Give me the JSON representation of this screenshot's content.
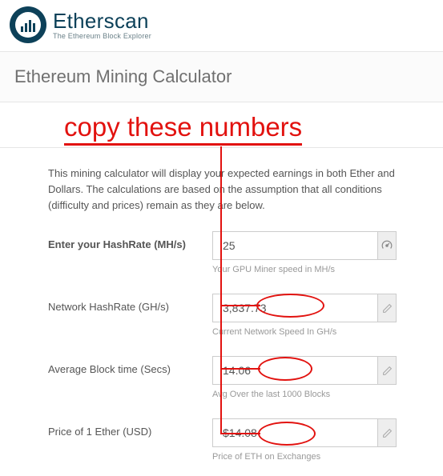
{
  "brand": {
    "title": "Etherscan",
    "subtitle": "The Ethereum Block Explorer"
  },
  "page": {
    "title": "Ethereum Mining Calculator",
    "intro": "This mining calculator will display your expected earnings in both Ether and Dollars. The calculations are based on the assumption that all conditions (difficulty and prices) remain as they are below."
  },
  "fields": {
    "hashrate": {
      "label": "Enter your HashRate (MH/s)",
      "value": "25",
      "helper": "Your GPU Miner speed in MH/s"
    },
    "network": {
      "label": "Network HashRate (GH/s)",
      "value": "3,837.73",
      "helper": "Current Network Speed In GH/s"
    },
    "blocktime": {
      "label": "Average Block time (Secs)",
      "value": "14.06",
      "helper": "Avg Over the last 1000 Blocks"
    },
    "price": {
      "label": "Price of 1 Ether (USD)",
      "value": "$14.08",
      "helper": "Price of ETH on Exchanges"
    }
  },
  "annotation": {
    "text": "copy these numbers"
  }
}
